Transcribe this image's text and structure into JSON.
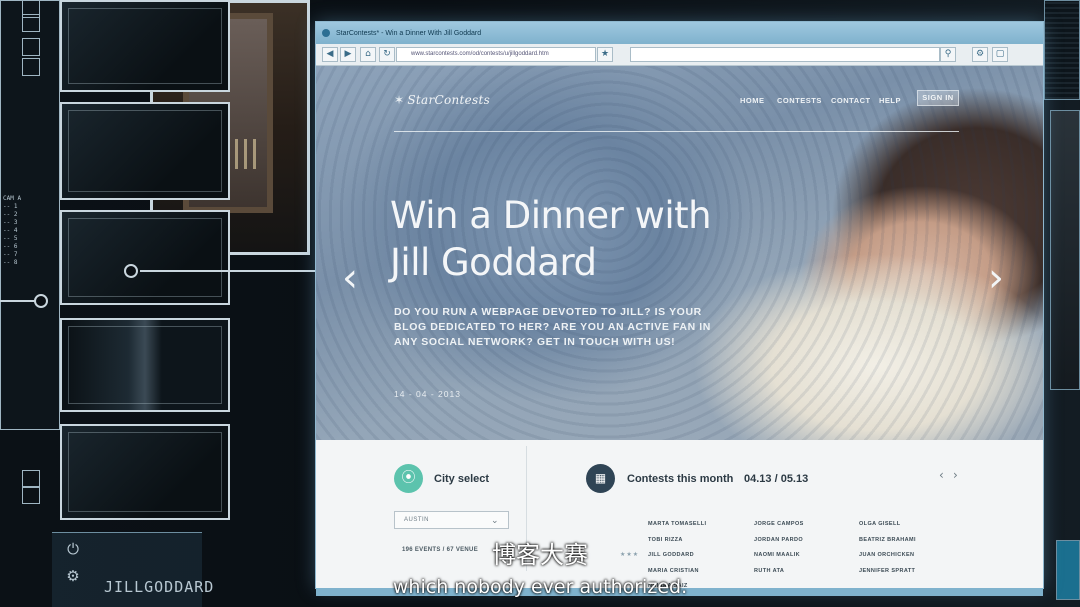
{
  "browser": {
    "title": "StarContests* - Win a Dinner With Jill Goddard",
    "url": "www.starcontests.com/od/contests/u/jillgoddard.htm",
    "nav_icons": [
      "back-arrow-icon",
      "forward-arrow-icon",
      "home-icon",
      "refresh-icon",
      "star-icon",
      "search-icon",
      "settings-icon",
      "page-icon"
    ]
  },
  "site": {
    "brand": "StarContests",
    "nav": [
      {
        "label": "HOME"
      },
      {
        "label": "CONTESTS"
      },
      {
        "label": "CONTACT"
      },
      {
        "label": "HELP"
      }
    ],
    "sign_in": "SIGN IN"
  },
  "hero": {
    "headline_line1": "Win a Dinner with",
    "headline_line2": "Jill Goddard",
    "subcopy": "DO YOU RUN A WEBPAGE DEVOTED TO JILL? IS YOUR BLOG DEDICATED TO HER? ARE YOU AN ACTIVE FAN IN ANY SOCIAL NETWORK? GET IN TOUCH WITH US!",
    "date": "14 - 04 - 2013"
  },
  "city_select": {
    "title": "City select",
    "selected": "AUSTIN",
    "events": "196 EVENTS / 67 VENUE"
  },
  "contests": {
    "title": "Contests this month",
    "range": "04.13 / 05.13",
    "col1": [
      "MARTA TOMASELLI",
      "TOBI RIZZA",
      "JILL GODDARD",
      "MARIA CRISTIAN",
      "NAIARA SAIZ"
    ],
    "col2": [
      "JORGE CAMPOS",
      "JORDAN PARDO",
      "NAOMI MAALIK",
      "RUTH ATA"
    ],
    "col3": [
      "OLGA GISELL",
      "BEATRIZ BRAHAMI",
      "JUAN ORCHICKEN",
      "JENNIFER SPRATT"
    ]
  },
  "overlay": {
    "tag": "JILLGODDARD",
    "icons": [
      "power-icon",
      "gear-icon"
    ]
  },
  "subtitles": {
    "chinese": "博客大赛",
    "english": "which nobody ever authorized."
  },
  "colors": {
    "accent_teal": "#5cc3ad",
    "calendar_navy": "#2f4455",
    "window_chrome": "#7fb2cd"
  }
}
